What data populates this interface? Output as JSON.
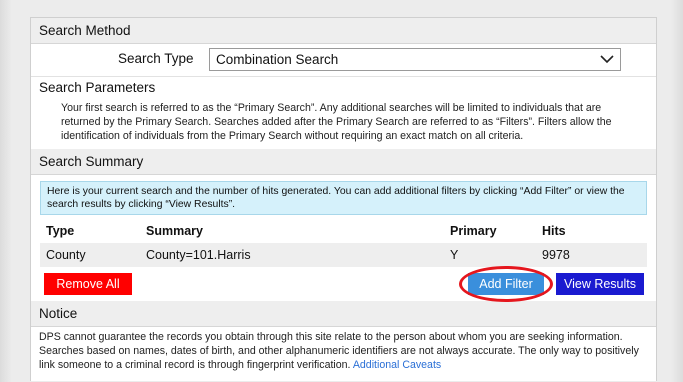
{
  "search_method": {
    "header": "Search Method",
    "type_label": "Search Type",
    "type_value": "Combination Search"
  },
  "search_parameters": {
    "header": "Search Parameters",
    "text": "Your first search is referred to as the “Primary Search”. Any additional searches will be limited to individuals that are returned by the Primary Search.  Searches added after the Primary Search are referred to as “Filters”.  Filters allow the identification of individuals from the Primary Search without requiring an exact match on all criteria."
  },
  "search_summary": {
    "header": "Search Summary",
    "info": "Here is your current search and the number of hits generated.  You can add additional filters by clicking “Add Filter” or view the search results by clicking “View Results”.",
    "columns": [
      "Type",
      "Summary",
      "Primary",
      "Hits"
    ],
    "rows": [
      {
        "type": "County",
        "summary": "County=101.Harris",
        "primary": "Y",
        "hits": "9978"
      }
    ],
    "remove_all_label": "Remove All",
    "add_filter_label": "Add Filter",
    "view_results_label": "View Results"
  },
  "notice": {
    "header": "Notice",
    "text": "DPS cannot guarantee the records you obtain through this site relate to the person about whom you are seeking information.  Searches based on names, dates of birth, and other alphanumeric identifiers are not always accurate.  The only way to positively link someone to a criminal record is through fingerprint verification.",
    "link_label": "Additional Caveats"
  },
  "colors": {
    "remove_button": "#ff0000",
    "add_filter_button": "#3a8fdc",
    "view_results_button": "#1a1ad0",
    "info_background": "#d5f1fb",
    "highlight_ring": "#e5161d"
  }
}
